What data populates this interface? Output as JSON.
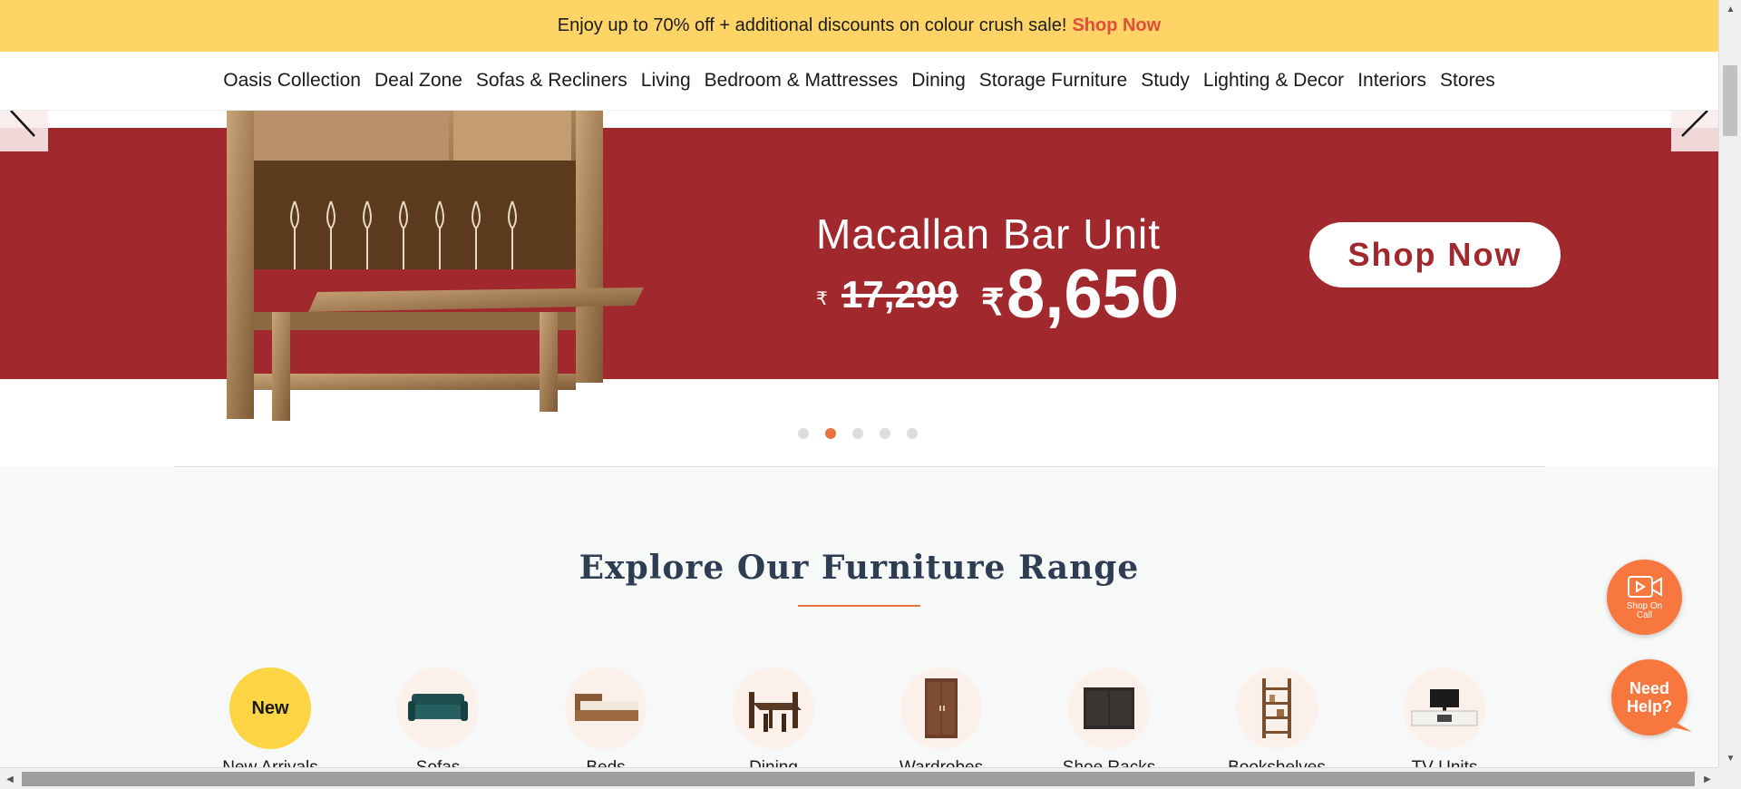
{
  "promo": {
    "text": "Enjoy up to 70% off + additional discounts on colour crush sale!",
    "link": "Shop Now"
  },
  "nav": {
    "items": [
      "Oasis Collection",
      "Deal Zone",
      "Sofas & Recliners",
      "Living",
      "Bedroom & Mattresses",
      "Dining",
      "Storage Furniture",
      "Study",
      "Lighting & Decor",
      "Interiors",
      "Stores"
    ]
  },
  "banner": {
    "title": "Macallan Bar Unit",
    "currency": "₹",
    "old_price": "17,299",
    "new_price": "8,650",
    "cta": "Shop Now",
    "color": "#a1282d"
  },
  "carousel": {
    "slide_count": 5,
    "active_index": 1,
    "prev_icon": "arrow-left-icon",
    "next_icon": "arrow-right-icon"
  },
  "section": {
    "title": "Explore Our Furniture Range"
  },
  "categories": [
    {
      "label": "New Arrivals",
      "badge": "New",
      "icon": "new-badge"
    },
    {
      "label": "Sofas",
      "icon": "sofa-icon"
    },
    {
      "label": "Beds",
      "icon": "bed-icon"
    },
    {
      "label": "Dining",
      "icon": "dining-set-icon"
    },
    {
      "label": "Wardrobes",
      "icon": "wardrobe-icon"
    },
    {
      "label": "Shoe Racks",
      "icon": "shoe-rack-icon"
    },
    {
      "label": "Bookshelves",
      "icon": "bookshelf-icon"
    },
    {
      "label": "TV Units",
      "icon": "tv-unit-icon"
    }
  ],
  "floating": {
    "call_label": "Shop On Call",
    "help_label": "Need Help?",
    "accent": "#f7773f"
  }
}
